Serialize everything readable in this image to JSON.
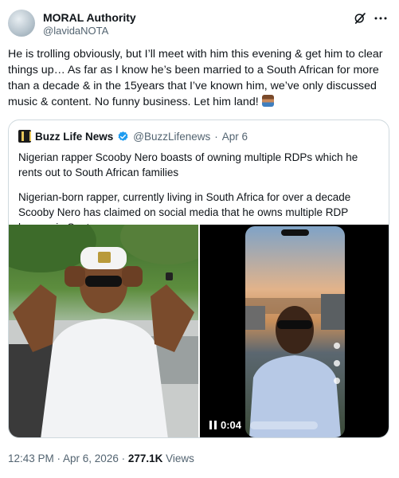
{
  "author": {
    "display_name": "MORAL Authority",
    "handle": "@lavidaNOTA"
  },
  "tweet": {
    "text": "He is trolling obviously, but I’ll meet with him this evening & get him to clear things up… As far as I know he’s been married to a South African for more than a decade & in the 15years that I’ve known him, we’ve only discussed music & content. No funny business. Let him land!"
  },
  "quote": {
    "name": "Buzz Life News",
    "handle": "@BuzzLifenews",
    "separator": "·",
    "date": "Apr 6",
    "headline": "Nigerian rapper Scooby Nero boasts of owning multiple RDPs which he rents out to South African families",
    "body": "Nigerian-born rapper, currently living in South Africa for over a decade Scooby Nero has claimed on social media that he owns multiple RDP houses in Sout…",
    "video_duration": "0:04"
  },
  "footer": {
    "time_date": "12:43 PM · Apr 6, 2026 · ",
    "views_count": "277.1K",
    "views_label": " Views"
  },
  "colors": {
    "text_primary": "#0f1419",
    "text_secondary": "#536471",
    "verified": "#1d9bf0",
    "border": "#cfd9de"
  }
}
